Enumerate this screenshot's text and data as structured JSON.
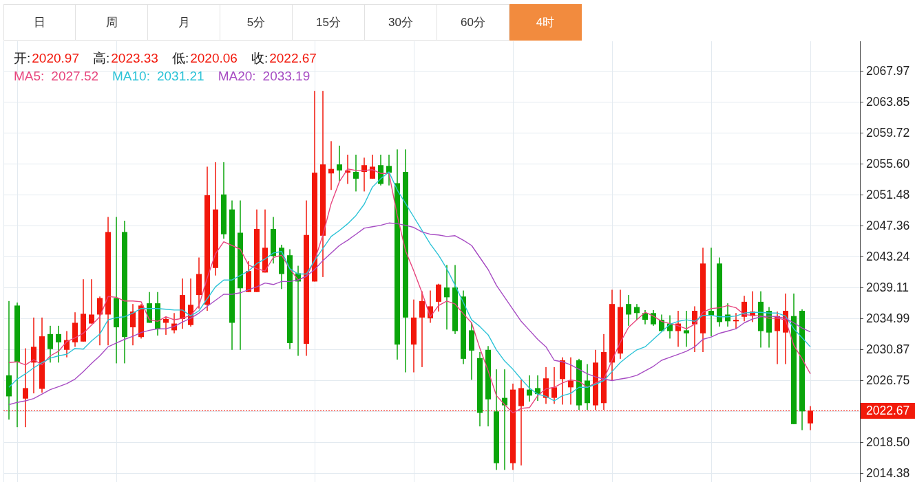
{
  "tabs": [
    {
      "label": "日",
      "selected": false
    },
    {
      "label": "周",
      "selected": false
    },
    {
      "label": "月",
      "selected": false
    },
    {
      "label": "5分",
      "selected": false
    },
    {
      "label": "15分",
      "selected": false
    },
    {
      "label": "30分",
      "selected": false
    },
    {
      "label": "60分",
      "selected": false
    },
    {
      "label": "4时",
      "selected": true
    }
  ],
  "quote": {
    "fields": [
      {
        "label": "开:",
        "value": "2020.97"
      },
      {
        "label": "高:",
        "value": "2023.33"
      },
      {
        "label": "低:",
        "value": "2020.06"
      },
      {
        "label": "收:",
        "value": "2022.67"
      }
    ],
    "moving_average_values": [
      "2027.52",
      "2031.21",
      "2033.19"
    ]
  },
  "chart": {
    "chart_data": {
      "type": "candlestick",
      "grid": true,
      "ylim": [
        2013.19,
        2071.91
      ],
      "yticks": [
        2067.97,
        2063.85,
        2059.72,
        {
          "value": 2055.6,
          "label": "2055.60"
        },
        2051.48,
        2047.36,
        2043.24,
        2039.11,
        2034.99,
        2030.87,
        2026.75,
        {
          "value": 2018.5,
          "label": "2018.50"
        },
        2014.38
      ],
      "ohlc": [
        [
          2027.4,
          2037.3,
          2021.5,
          2024.6
        ],
        [
          2036.7,
          2037.1,
          2020.5,
          2029.2
        ],
        [
          2024.3,
          2031.0,
          2020.5,
          2025.7
        ],
        [
          2029.1,
          2035.1,
          2025.0,
          2031.2
        ],
        [
          2025.6,
          2035.1,
          2025.1,
          2032.6
        ],
        [
          2032.9,
          2034.0,
          2029.1,
          2030.9
        ],
        [
          2032.9,
          2034.0,
          2029.1,
          2031.8
        ],
        [
          2030.8,
          2033.3,
          2029.8,
          2032.1
        ],
        [
          2031.8,
          2035.8,
          2031.2,
          2034.4
        ],
        [
          2031.9,
          2040.2,
          2031.9,
          2035.6
        ],
        [
          2034.3,
          2040.2,
          2034.3,
          2035.5
        ],
        [
          2035.5,
          2037.9,
          2031.4,
          2037.7
        ],
        [
          2035.5,
          2048.5,
          2031.4,
          2046.5
        ],
        [
          2037.7,
          2048.5,
          2029.0,
          2033.8
        ],
        [
          2046.5,
          2048.0,
          2029.0,
          2032.5
        ],
        [
          2033.8,
          2036.9,
          2031.4,
          2035.9
        ],
        [
          2032.5,
          2036.9,
          2032.3,
          2036.7
        ],
        [
          2037.0,
          2038.5,
          2034.4,
          2034.4
        ],
        [
          2037.0,
          2038.5,
          2032.7,
          2033.6
        ],
        [
          2034.4,
          2035.2,
          2032.8,
          2034.9
        ],
        [
          2033.4,
          2035.7,
          2033.0,
          2034.3
        ],
        [
          2034.9,
          2040.3,
          2033.6,
          2038.1
        ],
        [
          2034.1,
          2040.3,
          2033.9,
          2036.8
        ],
        [
          2038.1,
          2043.1,
          2036.3,
          2040.9
        ],
        [
          2036.8,
          2055.2,
          2036.0,
          2051.4
        ],
        [
          2041.7,
          2055.8,
          2040.7,
          2049.5
        ],
        [
          2051.5,
          2055.8,
          2045.6,
          2046.2
        ],
        [
          2049.5,
          2050.7,
          2030.8,
          2034.4
        ],
        [
          2046.4,
          2050.7,
          2030.8,
          2039.0
        ],
        [
          2038.5,
          2042.6,
          2038.5,
          2041.3
        ],
        [
          2038.5,
          2049.5,
          2038.5,
          2046.9
        ],
        [
          2041.1,
          2049.5,
          2041.1,
          2044.4
        ],
        [
          2046.9,
          2048.5,
          2042.3,
          2043.3
        ],
        [
          2044.4,
          2044.8,
          2038.9,
          2040.9
        ],
        [
          2043.4,
          2044.2,
          2030.9,
          2031.7
        ],
        [
          2041.0,
          2042.0,
          2030.0,
          2039.9
        ],
        [
          2031.6,
          2050.7,
          2030.0,
          2046.1
        ],
        [
          2039.9,
          2065.3,
          2039.9,
          2054.4
        ],
        [
          2046.0,
          2065.3,
          2040.5,
          2055.5
        ],
        [
          2054.3,
          2058.6,
          2052.1,
          2054.9
        ],
        [
          2055.5,
          2058.0,
          2053.3,
          2054.7
        ],
        [
          2054.4,
          2056.8,
          2052.9,
          2054.7
        ],
        [
          2054.5,
          2056.8,
          2051.9,
          2053.6
        ],
        [
          2054.5,
          2056.4,
          2051.9,
          2055.4
        ],
        [
          2053.6,
          2056.8,
          2053.6,
          2055.2
        ],
        [
          2055.4,
          2056.8,
          2052.7,
          2052.9
        ],
        [
          2055.3,
          2056.8,
          2052.7,
          2054.4
        ],
        [
          2053.0,
          2057.5,
          2029.5,
          2031.5
        ],
        [
          2054.5,
          2057.5,
          2027.8,
          2035.1
        ],
        [
          2031.5,
          2037.5,
          2027.8,
          2035.1
        ],
        [
          2035.1,
          2038.6,
          2028.5,
          2037.3
        ],
        [
          2035.0,
          2038.7,
          2034.4,
          2036.6
        ],
        [
          2037.2,
          2039.6,
          2035.9,
          2039.5
        ],
        [
          2039.1,
          2042.1,
          2033.5,
          2037.8
        ],
        [
          2039.1,
          2042.1,
          2032.9,
          2033.3
        ],
        [
          2037.9,
          2038.7,
          2028.9,
          2029.6
        ],
        [
          2033.4,
          2034.4,
          2026.8,
          2030.7
        ],
        [
          2029.7,
          2030.5,
          2020.6,
          2022.4
        ],
        [
          2030.8,
          2031.3,
          2020.6,
          2024.2
        ],
        [
          2022.6,
          2028.2,
          2014.8,
          2015.7
        ],
        [
          2024.4,
          2028.2,
          2014.8,
          2023.4
        ],
        [
          2015.7,
          2026.3,
          2014.8,
          2025.5
        ],
        [
          2023.3,
          2026.8,
          2015.4,
          2025.7
        ],
        [
          2025.5,
          2027.4,
          2023.9,
          2024.7
        ],
        [
          2025.7,
          2027.4,
          2024.0,
          2024.9
        ],
        [
          2024.4,
          2028.5,
          2023.6,
          2027.0
        ],
        [
          2024.4,
          2028.5,
          2023.6,
          2025.8
        ],
        [
          2026.9,
          2029.8,
          2023.5,
          2029.4
        ],
        [
          2025.8,
          2029.8,
          2023.5,
          2026.7
        ],
        [
          2029.4,
          2029.6,
          2022.8,
          2023.4
        ],
        [
          2026.7,
          2028.9,
          2022.8,
          2023.7
        ],
        [
          2023.4,
          2030.8,
          2022.8,
          2029.1
        ],
        [
          2023.7,
          2032.9,
          2022.8,
          2030.5
        ],
        [
          2029.1,
          2038.8,
          2026.7,
          2036.9
        ],
        [
          2030.3,
          2038.8,
          2029.6,
          2036.5
        ],
        [
          2036.9,
          2038.1,
          2034.0,
          2035.5
        ],
        [
          2036.5,
          2036.9,
          2034.8,
          2035.7
        ],
        [
          2035.7,
          2036.1,
          2034.2,
          2034.8
        ],
        [
          2035.7,
          2036.1,
          2034.0,
          2034.2
        ],
        [
          2034.8,
          2035.5,
          2033.3,
          2033.3
        ],
        [
          2034.3,
          2035.4,
          2032.3,
          2033.3
        ],
        [
          2033.3,
          2036.0,
          2031.2,
          2034.3
        ],
        [
          2033.4,
          2036.0,
          2031.2,
          2033.0
        ],
        [
          2034.2,
          2036.6,
          2030.5,
          2036.0
        ],
        [
          2033.0,
          2044.4,
          2030.5,
          2042.3
        ],
        [
          2036.0,
          2044.4,
          2032.6,
          2035.4
        ],
        [
          2042.3,
          2043.1,
          2033.9,
          2034.5
        ],
        [
          2035.5,
          2037.0,
          2033.9,
          2034.6
        ],
        [
          2034.6,
          2035.7,
          2033.6,
          2034.8
        ],
        [
          2035.2,
          2038.0,
          2034.6,
          2037.2
        ],
        [
          2035.3,
          2038.6,
          2034.5,
          2035.9
        ],
        [
          2037.2,
          2038.6,
          2031.1,
          2033.3
        ],
        [
          2036.0,
          2036.5,
          2031.1,
          2033.1
        ],
        [
          2033.3,
          2035.9,
          2028.9,
          2035.3
        ],
        [
          2033.1,
          2038.3,
          2028.9,
          2036.0
        ],
        [
          2035.3,
          2038.3,
          2020.9,
          2020.9
        ],
        [
          2036.0,
          2036.2,
          2020.1,
          2022.6
        ],
        [
          2021.0,
          2023.3,
          2020.1,
          2022.7
        ]
      ],
      "series": [
        {
          "name": "MA5:",
          "type": "line",
          "color": "#e8457d",
          "values": [
            2029.1,
            2029.2,
            2028.8,
            2029.5,
            2028.8,
            2030.0,
            2030.6,
            2031.9,
            2032.4,
            2033.0,
            2034.1,
            2035.2,
            2037.9,
            2037.8,
            2037.3,
            2037.3,
            2037.2,
            2034.8,
            2034.6,
            2035.2,
            2034.8,
            2035.0,
            2035.4,
            2036.7,
            2040.4,
            2043.6,
            2045.2,
            2044.7,
            2044.2,
            2042.1,
            2041.6,
            2041.3,
            2043.1,
            2043.4,
            2041.6,
            2040.1,
            2040.6,
            2042.7,
            2046.1,
            2050.3,
            2053.2,
            2054.9,
            2054.7,
            2054.7,
            2054.8,
            2054.3,
            2054.3,
            2048.7,
            2044.0,
            2041.3,
            2038.4,
            2035.2,
            2036.7,
            2037.3,
            2036.9,
            2035.6,
            2034.4,
            2031.0,
            2028.0,
            2024.7,
            2023.5,
            2022.4,
            2023.0,
            2023.1,
            2024.7,
            2025.6,
            2025.8,
            2026.4,
            2026.8,
            2026.6,
            2025.8,
            2026.4,
            2026.9,
            2029.4,
            2031.8,
            2033.8,
            2034.8,
            2035.8,
            2035.3,
            2034.6,
            2034.3,
            2034.0,
            2033.6,
            2034.2,
            2035.8,
            2036.3,
            2036.4,
            2036.7,
            2036.4,
            2035.5,
            2035.4,
            2035.3,
            2035.0,
            2035.0,
            2034.8,
            2031.4,
            2029.6,
            2027.6
          ]
        },
        {
          "name": "MA10:",
          "type": "line",
          "color": "#2cc3d7",
          "values": [
            2025.8,
            2026.9,
            2027.6,
            2028.4,
            2029.1,
            2029.7,
            2030.0,
            2030.2,
            2031.0,
            2030.9,
            2032.0,
            2032.9,
            2034.8,
            2035.1,
            2035.2,
            2035.7,
            2036.3,
            2036.3,
            2036.3,
            2036.2,
            2036.1,
            2036.1,
            2035.3,
            2036.0,
            2037.6,
            2039.2,
            2040.1,
            2040.1,
            2040.7,
            2041.3,
            2042.3,
            2042.9,
            2043.7,
            2043.9,
            2041.6,
            2040.9,
            2040.9,
            2042.7,
            2044.3,
            2045.9,
            2046.7,
            2047.6,
            2048.7,
            2050.2,
            2052.5,
            2053.6,
            2054.5,
            2052.1,
            2050.3,
            2048.5,
            2046.7,
            2044.9,
            2043.4,
            2041.6,
            2039.4,
            2037.1,
            2034.8,
            2033.9,
            2032.8,
            2030.8,
            2029.3,
            2028.2,
            2026.9,
            2025.7,
            2024.9,
            2024.6,
            2024.0,
            2024.7,
            2025.0,
            2025.8,
            2025.8,
            2026.2,
            2026.7,
            2027.9,
            2029.1,
            2030.0,
            2030.8,
            2031.2,
            2032.2,
            2033.2,
            2034.2,
            2034.6,
            2034.8,
            2034.6,
            2035.4,
            2035.4,
            2035.2,
            2035.2,
            2035.3,
            2035.7,
            2035.8,
            2035.8,
            2035.7,
            2035.7,
            2035.3,
            2033.6,
            2032.4,
            2031.2
          ]
        },
        {
          "name": "MA20:",
          "type": "line",
          "color": "#a74cc3",
          "values": [
            2023.5,
            2023.8,
            2024.0,
            2024.3,
            2024.9,
            2025.5,
            2025.9,
            2026.3,
            2026.9,
            2027.9,
            2029.0,
            2030.0,
            2031.2,
            2031.7,
            2032.2,
            2032.6,
            2033.1,
            2033.4,
            2033.6,
            2033.6,
            2033.9,
            2034.5,
            2035.0,
            2035.7,
            2036.6,
            2037.4,
            2038.2,
            2038.2,
            2038.4,
            2038.8,
            2039.2,
            2039.7,
            2039.5,
            2039.9,
            2039.9,
            2040.1,
            2040.6,
            2041.5,
            2042.7,
            2043.7,
            2044.7,
            2045.4,
            2046.2,
            2047.0,
            2047.2,
            2047.4,
            2047.7,
            2047.6,
            2047.4,
            2047.1,
            2046.5,
            2046.2,
            2046.1,
            2045.9,
            2046.0,
            2045.4,
            2044.7,
            2043.1,
            2041.5,
            2039.4,
            2037.8,
            2036.2,
            2034.6,
            2033.4,
            2032.2,
            2031.2,
            2029.4,
            2029.2,
            2028.8,
            2028.2,
            2027.6,
            2027.2,
            2026.9,
            2026.7,
            2026.9,
            2027.1,
            2027.4,
            2028.0,
            2028.6,
            2029.4,
            2029.8,
            2030.2,
            2030.6,
            2031.2,
            2032.2,
            2032.5,
            2033.0,
            2033.3,
            2033.6,
            2034.4,
            2034.9,
            2035.2,
            2035.3,
            2035.2,
            2035.0,
            2034.4,
            2033.7,
            2033.2
          ]
        }
      ],
      "ref_lines": [
        {
          "axis": "y",
          "value": 2022.67,
          "label": "2022.67"
        }
      ]
    }
  }
}
